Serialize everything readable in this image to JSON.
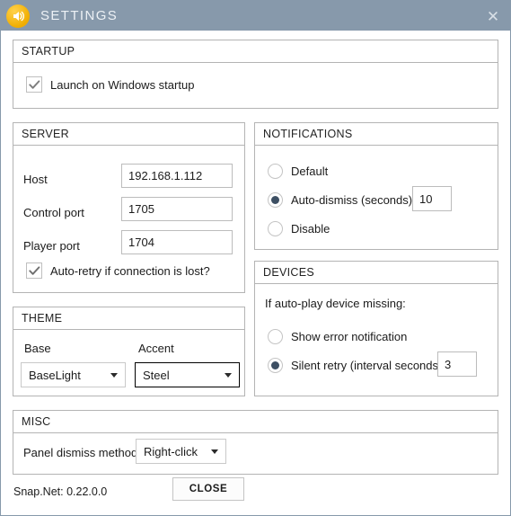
{
  "titlebar": {
    "title": "SETTINGS",
    "app_icon": "speaker-icon",
    "close_glyph": "✕",
    "bg_color": "#8799ab",
    "icon_color": "#f2b705"
  },
  "startup": {
    "header": "STARTUP",
    "launch_checkbox": {
      "label": "Launch on Windows startup",
      "checked": true
    }
  },
  "server": {
    "header": "SERVER",
    "fields": [
      {
        "label": "Host",
        "value": "192.168.1.112"
      },
      {
        "label": "Control port",
        "value": "1705"
      },
      {
        "label": "Player port",
        "value": "1704"
      }
    ],
    "auto_retry": {
      "label": "Auto-retry if connection is lost?",
      "checked": true
    }
  },
  "theme": {
    "header": "THEME",
    "base": {
      "label": "Base",
      "value": "BaseLight"
    },
    "accent": {
      "label": "Accent",
      "value": "Steel"
    }
  },
  "notifications": {
    "header": "NOTIFICATIONS",
    "options": [
      {
        "label": "Default",
        "selected": false
      },
      {
        "label": "Auto-dismiss (seconds):",
        "selected": true
      },
      {
        "label": "Disable",
        "selected": false
      }
    ],
    "auto_dismiss_value": "10"
  },
  "devices": {
    "header": "DEVICES",
    "description": "If auto-play device missing:",
    "options": [
      {
        "label": "Show error notification",
        "selected": false
      },
      {
        "label": "Silent retry (interval seconds)",
        "selected": true
      }
    ],
    "retry_interval_value": "3"
  },
  "misc": {
    "header": "MISC",
    "panel_dismiss": {
      "label": "Panel dismiss method",
      "value": "Right-click"
    }
  },
  "footer": {
    "version": "Snap.Net: 0.22.0.0",
    "close_label": "CLOSE"
  }
}
